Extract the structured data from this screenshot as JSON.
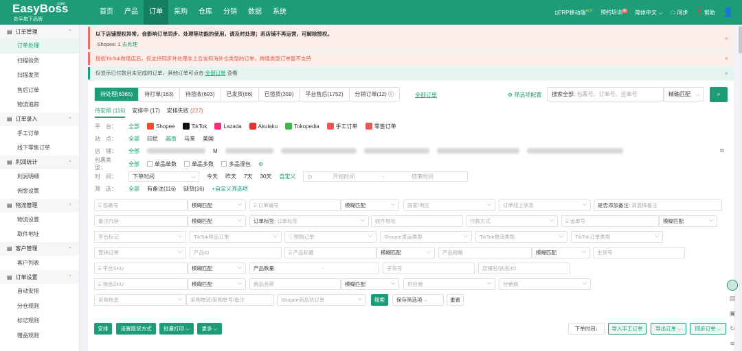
{
  "brand": {
    "name": "EasyBoss",
    "dotcom": ".com",
    "tagline": "妙手旗下品牌"
  },
  "nav": [
    "首页",
    "产品",
    "订单",
    "采购",
    "仓库",
    "分销",
    "数据",
    "系统"
  ],
  "topright": {
    "erp": "ERP移动端",
    "hot": "HOT",
    "training": "预约培训",
    "new": "新",
    "lang": "简体中文",
    "sync": "同步",
    "help": "帮助"
  },
  "sidebar": [
    {
      "group": "订单管理",
      "items": [
        "订单处理",
        "扫描验货",
        "扫描发货",
        "售后订单",
        "物流追踪"
      ]
    },
    {
      "group": "订单录入",
      "items": [
        "手工订单",
        "线下零售订单"
      ]
    },
    {
      "group": "利润统计",
      "items": [
        "利润明细",
        "佣金设置"
      ]
    },
    {
      "group": "物流管理",
      "items": [
        "物流设置",
        "取件地址"
      ]
    },
    {
      "group": "客户管理",
      "items": [
        "客户列表"
      ]
    },
    {
      "group": "订单设置",
      "items": [
        "自动安排",
        "分仓规则",
        "标记规则",
        "赠品规则"
      ]
    }
  ],
  "alerts": {
    "a1_title": "以下店铺授权异常，会影响订单同步、处理等功能的使用，请及时处理；若店铺不再运营，可解除授权。",
    "a1_prefix": "·Shopee: 1 ",
    "a1_link": "去处理",
    "a2": "授权TikTok跨境店后，仅支持同步并处理本土仓发和海外仓类型的订单，跨境类型订单暂不支持",
    "a3_prefix": "仅显示已付款且未完成的订单，其他订单可点击 ",
    "a3_link": "全部订单",
    "a3_suffix": " 查看"
  },
  "tabs": [
    "待处理(6365)",
    "待打单(163)",
    "待揽收(693)",
    "已发货(86)",
    "已揽货(359)",
    "平台售后(1752)",
    "分销订单(12) ⓘ"
  ],
  "all_orders": "全部订单",
  "filter_config": "筛选项配置",
  "search": {
    "label": "搜索全部:",
    "placeholder": "包裹号、订单号、运单号",
    "match": "精确匹配"
  },
  "subtabs": {
    "pending": "待安排 (116)",
    "arranging": "安排中 (17)",
    "failed_label": "安排失败 ",
    "failed_count": "(227)"
  },
  "filters": {
    "platform_label": "平　台：",
    "platform_all": "全部",
    "platforms": [
      {
        "name": "Shopee",
        "color": "#ee4d2d"
      },
      {
        "name": "TikTok",
        "color": "#111111"
      },
      {
        "name": "Lazada",
        "color": "#f5317f"
      },
      {
        "name": "Akulaku",
        "color": "#e6322f"
      },
      {
        "name": "Tokopedia",
        "color": "#42b549"
      },
      {
        "name": "手工订单",
        "color": "#f0584f"
      },
      {
        "name": "零售订单",
        "color": "#f0584f"
      }
    ],
    "site_label": "站　点：",
    "site_all": "全部",
    "sites": [
      "印尼",
      "越南",
      "马来",
      "美国"
    ],
    "store_label": "店　铺：",
    "store_all": "全部",
    "store_m": "M",
    "pkg_label": "包裹类型：",
    "pkg_all": "全部",
    "pkg_types": [
      "单品单数",
      "单品多数",
      "多品混包"
    ],
    "time_label": "时　间：",
    "time_field": "下单时间",
    "time_opts": [
      "今天",
      "昨天",
      "7天",
      "30天"
    ],
    "time_custom": "自定义",
    "time_start": "开始时间",
    "time_sep": "-",
    "time_end": "结束时间",
    "screen_label": "筛　选：",
    "screen_all": "全部",
    "screen_opts": [
      "有备注(116)",
      "缺货(16)"
    ],
    "screen_custom": "+自定义筛选项"
  },
  "form": {
    "pkg_no": "包裹号",
    "fuzzy": "模糊匹配",
    "order_no": "订单编号",
    "country": "国家/地区",
    "online_status": "订单线上状态",
    "remark_label": "是否添加备注:",
    "remark_ph": "请选择备注",
    "remark_content": "备注内容",
    "order_tag_label": "订单标签:",
    "order_tag_ph": "订单标签",
    "recv_addr": "收件地址",
    "pay_method": "付款方式",
    "waybill": "运单号",
    "platform_tag": "平台标记",
    "tiktok_sample": "TikTok样品订单",
    "presale": "预购订单",
    "shopee_ship": "Shopee发运类型",
    "tiktok_logistics": "TikTok物流类型",
    "tiktok_order_type": "TikTok订单类型",
    "marketing": "营销订单",
    "product_id": "产品ID",
    "product_title": "产品标题",
    "product_spec": "产品规格",
    "main_sku": "主货号",
    "platform_sku": "平台SKU",
    "product_qty": "产品数量:",
    "qty_sep": "-",
    "sub_sku": "子货号",
    "store_alias": "店铺名/别名/ID",
    "goods_sku": "商品SKU",
    "goods_name": "商品名称",
    "supplier": "供应商",
    "sub_warehouse": "分销商",
    "purchase_info": "采购信息",
    "purchase_ph": "采购物流/采购单号/备注",
    "shopee_dl": "Shopee商品达订单",
    "search_btn": "搜索",
    "save_filter": "保存筛选项",
    "reset_btn": "重置"
  },
  "bottom": {
    "arrange": "安排",
    "set_ship": "设置揽货方式",
    "batch_print": "批量打印",
    "more": "更多",
    "sort": "下单时间↓",
    "import": "导入手工订单",
    "export": "导出订单",
    "sync_order": "同步订单"
  }
}
